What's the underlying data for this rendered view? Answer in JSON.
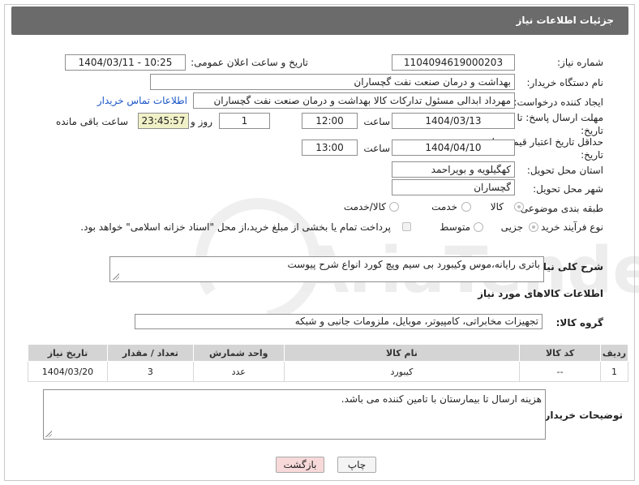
{
  "header": {
    "title": "جزئیات اطلاعات نیاز"
  },
  "fields": {
    "need_number": {
      "label": "شماره نیاز:",
      "value": "1104094619000203"
    },
    "announce": {
      "label": "تاریخ و ساعت اعلان عمومی:",
      "value": "1404/03/11 - 10:25"
    },
    "buyer": {
      "label": "نام دستگاه خریدار:",
      "value": "بهداشت و درمان صنعت نفت گچساران"
    },
    "creator": {
      "label": "ایجاد کننده درخواست:",
      "value": "مهرداد ابدالی مسئول تدارکات کالا  بهداشت و درمان صنعت نفت گچساران",
      "contact_link": "اطلاعات تماس خریدار"
    },
    "deadline": {
      "label": "مهلت ارسال پاسخ: تا تاریخ:",
      "date": "1404/03/13",
      "time_label": "ساعت",
      "time": "12:00",
      "days": "1",
      "days_label": "روز و",
      "remaining": "23:45:57",
      "remaining_label": "ساعت باقی مانده"
    },
    "validity": {
      "label": "حداقل تاریخ اعتبار قیمت: تا تاریخ:",
      "date": "1404/04/10",
      "time_label": "ساعت",
      "time": "13:00"
    },
    "province": {
      "label": "استان محل تحویل:",
      "value": "کهگیلویه و بویراحمد"
    },
    "city": {
      "label": "شهر محل تحویل:",
      "value": "گچساران"
    },
    "category": {
      "label": "طبقه بندی موضوعی:",
      "options": [
        "کالا",
        "خدمت",
        "کالا/خدمت"
      ],
      "selected": "کالا"
    },
    "process": {
      "label": "نوع فرآیند خرید :",
      "options": [
        "جزیی",
        "متوسط"
      ],
      "selected": "جزیی",
      "payment_note": "پرداخت تمام یا بخشی از مبلغ خرید،از محل \"اسناد خزانه اسلامی\" خواهد بود."
    }
  },
  "description": {
    "label": "شرح کلی نیاز:",
    "value": "باتری رایانه،موس وکیبورد بی سیم  وپچ کورد انواع شرح پیوست"
  },
  "goods_section": {
    "title": "اطلاعات کالاهای مورد نیاز"
  },
  "goods_group": {
    "label": "گروه کالا:",
    "value": "تجهیزات مخابراتی، کامپیوتر، موبایل، ملزومات جانبی و شبکه"
  },
  "table": {
    "headers": [
      "ردیف",
      "کد کالا",
      "نام کالا",
      "واحد شمارش",
      "تعداد / مقدار",
      "تاریخ نیاز"
    ],
    "rows": [
      [
        "1",
        "--",
        "کیبورد",
        "عدد",
        "3",
        "1404/03/20"
      ]
    ]
  },
  "buyer_notes": {
    "label": "توضیحات خریدار:",
    "value": "هزینه ارسال تا بیمارستان با تامین کننده می باشد."
  },
  "buttons": {
    "print": "چاپ",
    "back": "بازگشت"
  },
  "watermark": {
    "text": "AriaTender.neT"
  },
  "colors": {
    "header_bg": "#6b6b6b",
    "link": "#1b55c7",
    "back_button_bg": "#f7d9d9",
    "table_header_bg": "#d4d4d4"
  }
}
